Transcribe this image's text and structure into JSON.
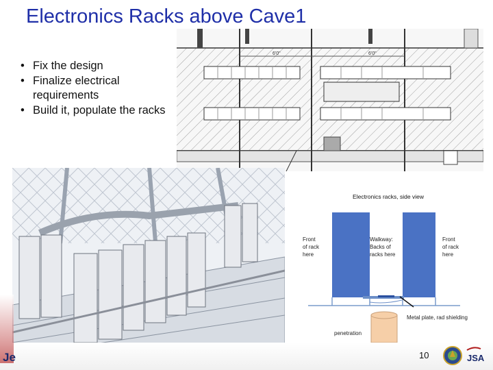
{
  "slide": {
    "title": "Electronics Racks above Cave1",
    "bullets": [
      "Fix the design",
      "Finalize electrical requirements",
      "Build it, populate the racks"
    ],
    "page_number": "10",
    "footer_logo_text": "Je",
    "footer_logo2_text": "JSA"
  },
  "side_view": {
    "title": "Electronics racks, side view",
    "labels": {
      "front_left": [
        "Front",
        "of rack",
        "here"
      ],
      "walkway": [
        "Walkway:",
        "Backs of",
        "racks here"
      ],
      "front_right": [
        "Front",
        "of rack",
        "here"
      ],
      "metal_plate": "Metal plate, rad shielding",
      "penetration": "penetration"
    },
    "colors": {
      "rack": "#4a72c4",
      "penetration": "#f6cfa8",
      "floor": "#7a9ccc"
    }
  },
  "drawing_dims": [
    "6'0\"",
    "6'0\""
  ]
}
